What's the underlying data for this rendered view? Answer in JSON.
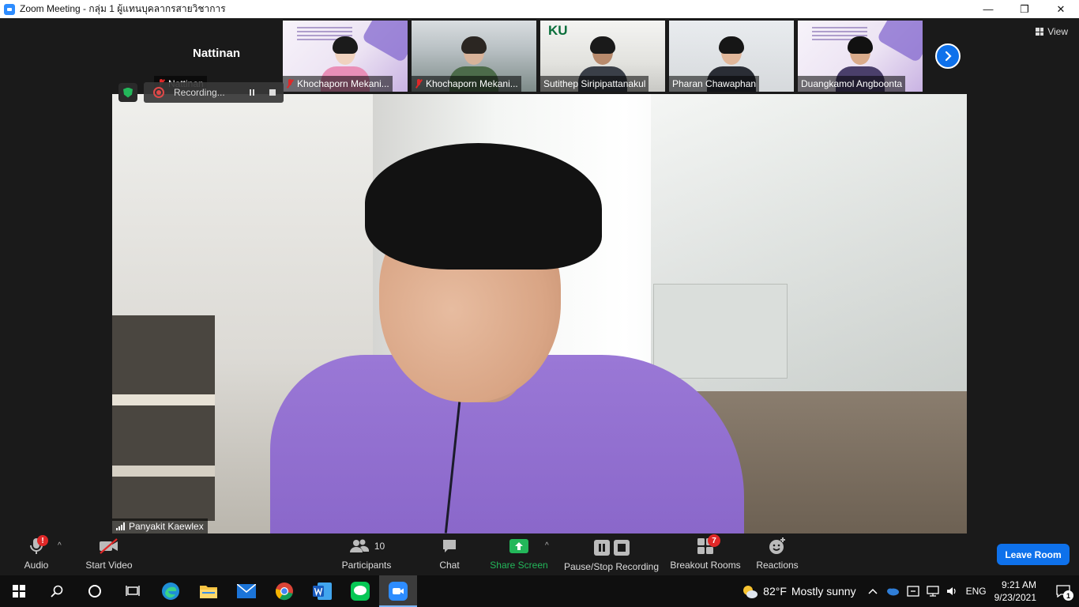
{
  "window": {
    "title": "Zoom Meeting - กลุ่ม 1 ผู้แทนบุคลากรสายวิชาการ",
    "minimize_glyph": "—",
    "restore_glyph": "❐",
    "close_glyph": "✕"
  },
  "view_button": {
    "label": "View"
  },
  "gallery": {
    "tiles": [
      {
        "name": "Nattinan",
        "display_name": "Nattinan",
        "muted": true
      },
      {
        "name": "Khochaporn Mekani...",
        "muted": true
      },
      {
        "name": "Khochaporn Mekani...",
        "muted": true
      },
      {
        "name": "Sutithep Siripipattanakul",
        "logo_text": "KU",
        "muted": false
      },
      {
        "name": "Pharan Chawaphan",
        "muted": false
      },
      {
        "name": "Duangkamol Angboonta",
        "muted": false
      }
    ],
    "next_icon": "chevron-right-icon"
  },
  "recording": {
    "status": "Recording..."
  },
  "main_video": {
    "speaker": "Panyakit Kaewlex"
  },
  "toolbar": {
    "audio": {
      "label": "Audio",
      "badge": "!"
    },
    "video": {
      "label": "Start Video"
    },
    "participants": {
      "label": "Participants",
      "count": "10"
    },
    "chat": {
      "label": "Chat"
    },
    "share": {
      "label": "Share Screen"
    },
    "recording": {
      "label": "Pause/Stop Recording"
    },
    "breakout": {
      "label": "Breakout Rooms",
      "badge": "7"
    },
    "reactions": {
      "label": "Reactions"
    },
    "leave": {
      "label": "Leave Room"
    },
    "caret": "^"
  },
  "colors": {
    "accent_blue": "#0e71eb",
    "share_green": "#23b75a",
    "alert_red": "#e02828"
  },
  "taskbar": {
    "weather": {
      "temp": "82°F",
      "condition": "Mostly sunny"
    },
    "language": "ENG",
    "time": "9:21 AM",
    "date": "9/23/2021",
    "notifications": "1"
  }
}
